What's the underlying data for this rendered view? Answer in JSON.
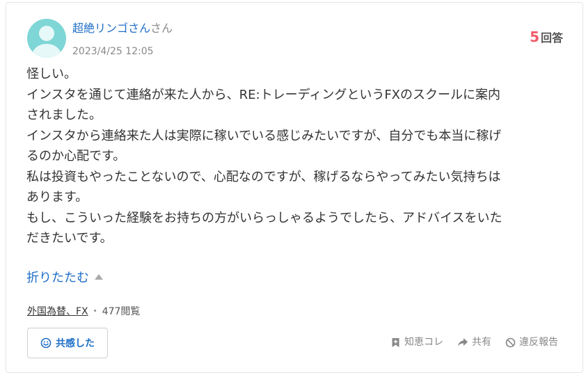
{
  "user": {
    "name": "超絶リンゴさん",
    "suffix": "さん",
    "date": "2023/4/25 12:05"
  },
  "answers": {
    "count": "5",
    "label": "回答"
  },
  "question": {
    "lines": [
      "怪しい。",
      "インスタを通じて連絡が来た人から、RE:トレーディングというFXのスクールに案内",
      "されました。",
      "インスタから連絡来た人は実際に稼いでいる感じみたいですが、自分でも本当に稼げ",
      "るのか心配です。",
      "私は投資もやったことないので、心配なのですが、稼げるならやってみたい気持ちは",
      "あります。",
      "もし、こういった経験をお持ちの方がいらっしゃるようでしたら、アドバイスをいた",
      "だきたいです。"
    ],
    "collapse_label": "折りたたむ"
  },
  "meta": {
    "category": "外国為替、FX",
    "separator": "・",
    "views": "477閲覧"
  },
  "buttons": {
    "empathy": "共感した",
    "knowledge": "知恵コレ",
    "share": "共有",
    "report": "違反報告"
  },
  "icons": {
    "avatar": "user-avatar-icon",
    "collapse": "triangle-up-icon",
    "empathy": "smile-icon",
    "knowledge": "bookmark-plus-icon",
    "share": "share-arrow-icon",
    "report": "prohibited-icon"
  },
  "colors": {
    "link": "#1e6ec8",
    "answer_count": "#ef5b6a",
    "avatar_bg": "#7fd6d6",
    "muted": "#888888"
  }
}
